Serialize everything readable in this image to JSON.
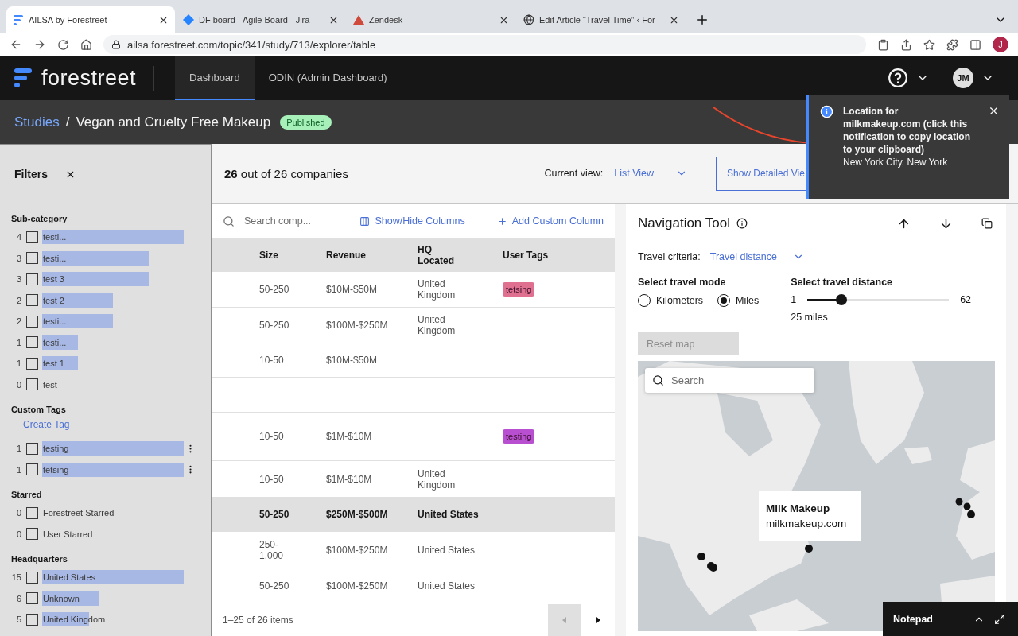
{
  "browser": {
    "tabs": [
      {
        "title": "AILSA by Forestreet",
        "kind": "forestreet",
        "selected": true
      },
      {
        "title": "DF board - Agile Board - Jira",
        "kind": "diamond",
        "selected": false
      },
      {
        "title": "Zendesk",
        "kind": "triangle",
        "selected": false
      },
      {
        "title": "Edit Article “Travel Time” ‹ For",
        "kind": "globe",
        "selected": false
      }
    ],
    "url": "ailsa.forestreet.com/topic/341/study/713/explorer/table",
    "profile": "J"
  },
  "app": {
    "logo": "forestreet",
    "nav": [
      {
        "label": "Dashboard",
        "selected": true
      },
      {
        "label": "ODIN (Admin Dashboard)",
        "selected": false
      }
    ],
    "avatar": "JM"
  },
  "breadcrumb": {
    "root": "Studies",
    "separator": "/",
    "title": "Vegan and Cruelty Free Makeup",
    "status": "Published"
  },
  "filters": {
    "title": "Filters",
    "groups": [
      {
        "title": "Sub-category",
        "items": [
          {
            "count": "4",
            "label": "testi...",
            "checked": false,
            "menu": false
          },
          {
            "count": "3",
            "label": "testi...",
            "checked": false,
            "menu": false
          },
          {
            "count": "3",
            "label": "test 3",
            "checked": false,
            "menu": false
          },
          {
            "count": "2",
            "label": "test 2",
            "checked": false,
            "menu": false
          },
          {
            "count": "2",
            "label": "testi...",
            "checked": false,
            "menu": false
          },
          {
            "count": "1",
            "label": "testi...",
            "checked": false,
            "menu": false
          },
          {
            "count": "1",
            "label": "test 1",
            "checked": false,
            "menu": false
          },
          {
            "count": "0",
            "label": "test",
            "checked": false,
            "menu": false
          }
        ]
      },
      {
        "title": "Custom Tags",
        "action": "Create Tag",
        "items": [
          {
            "count": "1",
            "label": "testing",
            "checked": false,
            "menu": true
          },
          {
            "count": "1",
            "label": "tetsing",
            "checked": false,
            "menu": true
          }
        ]
      },
      {
        "title": "Starred",
        "items": [
          {
            "count": "0",
            "label": "Forestreet Starred",
            "checked": false,
            "menu": false
          },
          {
            "count": "0",
            "label": "User Starred",
            "checked": false,
            "menu": false
          }
        ]
      },
      {
        "title": "Headquarters",
        "items": [
          {
            "count": "15",
            "label": "United States",
            "checked": false,
            "menu": false
          },
          {
            "count": "6",
            "label": "Unknown",
            "checked": false,
            "menu": false
          },
          {
            "count": "5",
            "label": "United Kingdom",
            "checked": false,
            "menu": false
          }
        ]
      }
    ]
  },
  "toolbar": {
    "count": "26",
    "count_text": "out of 26 companies",
    "view_label": "Current view:",
    "view": "List View",
    "detail_button": "Show Detailed Vie"
  },
  "table": {
    "search_placeholder": "Search comp...",
    "show_hide": "Show/Hide Columns",
    "add_column": "Add Custom Column",
    "columns": [
      "Size",
      "Revenue",
      "HQ Located",
      "User Tags"
    ],
    "rows": [
      {
        "cells": [
          "50-250",
          "$10M-$50M",
          "United Kingdom"
        ],
        "tag": {
          "label": "tetsing",
          "color": "#e0708f"
        },
        "selected": false
      },
      {
        "cells": [
          "50-250",
          "$100M-$250M",
          "United Kingdom"
        ],
        "selected": false
      },
      {
        "cells": [
          "10-50",
          "$10M-$50M"
        ],
        "selected": false
      },
      {
        "cells": [],
        "selected": false
      },
      {
        "cells": [
          "10-50",
          "$1M-$10M"
        ],
        "tag": {
          "label": "testing",
          "color": "#b84fd0"
        },
        "selected": false
      },
      {
        "cells": [
          "10-50",
          "$1M-$10M",
          "United Kingdom"
        ],
        "selected": false
      },
      {
        "cells": [
          "50-250",
          "$250M-$500M",
          "United States"
        ],
        "selected": true
      },
      {
        "cells": [
          "250-1,000",
          "$100M-$250M",
          "United States"
        ],
        "selected": false
      },
      {
        "cells": [
          "50-250",
          "$100M-$250M",
          "United States"
        ],
        "selected": false
      }
    ],
    "footer": "1–25 of 26 items"
  },
  "nav_tool": {
    "title": "Navigation Tool",
    "criteria_label": "Travel criteria:",
    "criteria": "Travel distance",
    "mode_label": "Select travel mode",
    "modes": [
      {
        "label": "Kilometers",
        "selected": false
      },
      {
        "label": "Miles",
        "selected": true
      }
    ],
    "distance_label": "Select travel distance",
    "min": "1",
    "max": "62",
    "level": 0.24,
    "reading": "25 miles",
    "reset": {
      "label": "Reset map",
      "disabled": true
    },
    "map": {
      "search_placeholder": "Search",
      "popup": {
        "title": "Milk Makeup",
        "subtitle": "milkmakeup.com"
      }
    }
  },
  "toast": {
    "title": "Location for milkmakeup.com (click this notification to copy location to your clipboard)",
    "body": "New York City, New York"
  },
  "notepad": {
    "title": "Notepad"
  }
}
